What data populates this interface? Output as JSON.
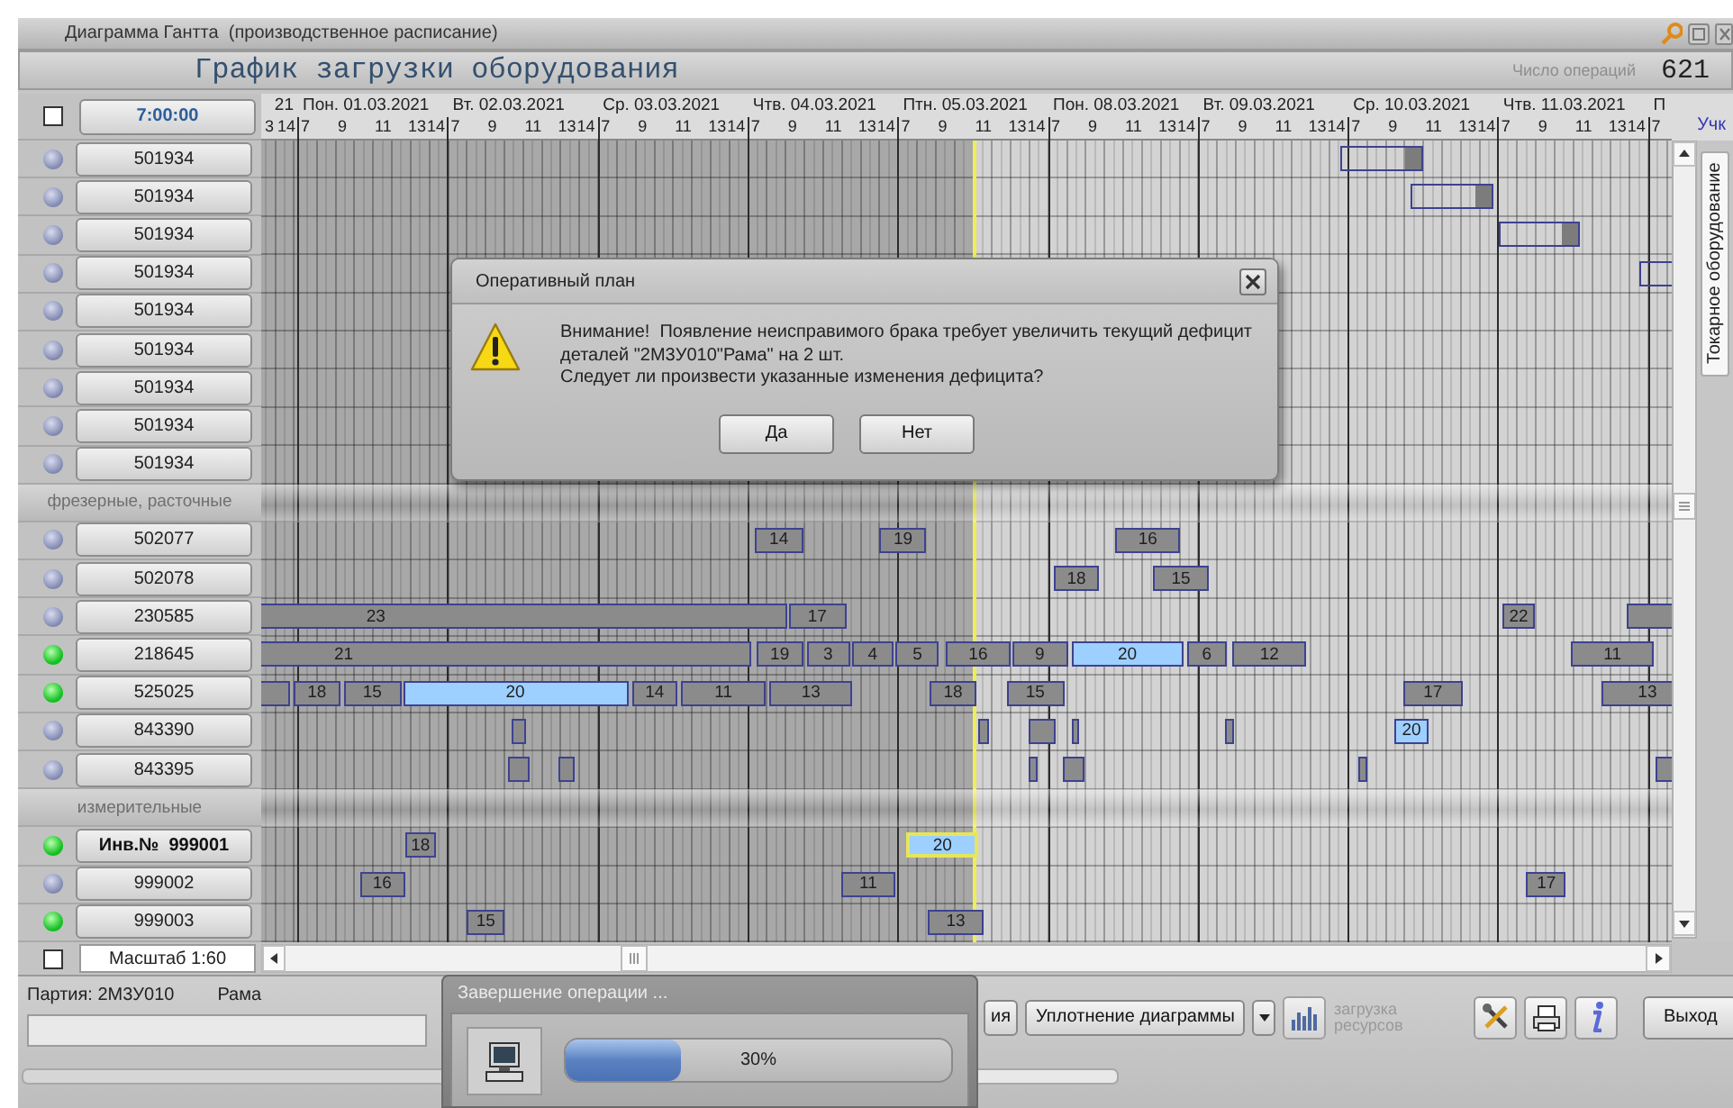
{
  "window": {
    "title": "Диаграмма Гантта  (производственное расписание)"
  },
  "header": {
    "title": "График загрузки оборудования",
    "count_label": "Число операций",
    "count": "621"
  },
  "toolbar": {
    "all_checked": false,
    "start_time": "7:00:00",
    "section_label": "Учк"
  },
  "timeline": {
    "days": [
      {
        "label": "21",
        "hours": [
          "3",
          "14"
        ]
      },
      {
        "label": "Пон. 01.03.2021",
        "hours": [
          "7",
          "9",
          "11",
          "13",
          "14"
        ]
      },
      {
        "label": "Вт. 02.03.2021",
        "hours": [
          "7",
          "9",
          "11",
          "13",
          "14"
        ]
      },
      {
        "label": "Ср. 03.03.2021",
        "hours": [
          "7",
          "9",
          "11",
          "13",
          "14"
        ]
      },
      {
        "label": "Чтв. 04.03.2021",
        "hours": [
          "7",
          "9",
          "11",
          "13",
          "14"
        ]
      },
      {
        "label": "Птн. 05.03.2021",
        "hours": [
          "7",
          "9",
          "11",
          "13",
          "14"
        ]
      },
      {
        "label": "Пон. 08.03.2021",
        "hours": [
          "7",
          "9",
          "11",
          "13",
          "14"
        ]
      },
      {
        "label": "Вт. 09.03.2021",
        "hours": [
          "7",
          "9",
          "11",
          "13",
          "14"
        ]
      },
      {
        "label": "Ср. 10.03.2021",
        "hours": [
          "7",
          "9",
          "11",
          "13",
          "14"
        ]
      },
      {
        "label": "Чтв. 11.03.2021",
        "hours": [
          "7",
          "9",
          "11",
          "13",
          "14"
        ]
      },
      {
        "label": "П",
        "hours": [
          "7"
        ]
      }
    ]
  },
  "rows": [
    {
      "kind": "machine",
      "label": "501934",
      "active": false,
      "selected": false,
      "bars": [
        {
          "kind": "pending"
        }
      ]
    },
    {
      "kind": "machine",
      "label": "501934",
      "active": false,
      "selected": false,
      "bars": [
        {
          "kind": "pending"
        }
      ]
    },
    {
      "kind": "machine",
      "label": "501934",
      "active": false,
      "selected": false,
      "bars": [
        {
          "kind": "pending"
        }
      ]
    },
    {
      "kind": "machine",
      "label": "501934",
      "active": false,
      "selected": false,
      "bars": [
        {
          "kind": "pending"
        }
      ]
    },
    {
      "kind": "machine",
      "label": "501934",
      "active": false,
      "selected": false
    },
    {
      "kind": "machine",
      "label": "501934",
      "active": false,
      "selected": false
    },
    {
      "kind": "machine",
      "label": "501934",
      "active": false,
      "selected": false
    },
    {
      "kind": "machine",
      "label": "501934",
      "active": false,
      "selected": false
    },
    {
      "kind": "machine",
      "label": "501934",
      "active": false,
      "selected": false
    },
    {
      "kind": "group",
      "label": "фрезерные, расточные"
    },
    {
      "kind": "machine",
      "label": "502077",
      "active": false,
      "selected": false,
      "bars": [
        {
          "kind": "operation",
          "label": "14"
        },
        {
          "kind": "operation",
          "label": "19"
        },
        {
          "kind": "operation",
          "label": "16"
        }
      ]
    },
    {
      "kind": "machine",
      "label": "502078",
      "active": false,
      "selected": false,
      "bars": [
        {
          "kind": "operation",
          "label": "18"
        },
        {
          "kind": "operation",
          "label": "15"
        }
      ]
    },
    {
      "kind": "machine",
      "label": "230585",
      "active": false,
      "selected": false,
      "bars": [
        {
          "kind": "operation",
          "label": "23"
        },
        {
          "kind": "operation",
          "label": "17"
        },
        {
          "kind": "operation",
          "label": "22"
        },
        {
          "kind": "operation"
        }
      ]
    },
    {
      "kind": "machine",
      "label": "218645",
      "active": true,
      "selected": false,
      "bars": [
        {
          "kind": "operation",
          "label": "21"
        },
        {
          "kind": "operation",
          "label": "19"
        },
        {
          "kind": "operation",
          "label": "3"
        },
        {
          "kind": "operation",
          "label": "4"
        },
        {
          "kind": "operation",
          "label": "5"
        },
        {
          "kind": "operation",
          "label": "16"
        },
        {
          "kind": "operation",
          "label": "9"
        },
        {
          "kind": "highlighted",
          "label": "20"
        },
        {
          "kind": "operation",
          "label": "6"
        },
        {
          "kind": "operation",
          "label": "12"
        },
        {
          "kind": "operation",
          "label": "11"
        }
      ]
    },
    {
      "kind": "machine",
      "label": "525025",
      "active": true,
      "selected": false,
      "bars": [
        {
          "kind": "operation"
        },
        {
          "kind": "operation",
          "label": "18"
        },
        {
          "kind": "operation",
          "label": "15"
        },
        {
          "kind": "highlighted",
          "label": "20"
        },
        {
          "kind": "operation",
          "label": "14"
        },
        {
          "kind": "operation",
          "label": "11"
        },
        {
          "kind": "operation",
          "label": "13"
        },
        {
          "kind": "operation",
          "label": "18"
        },
        {
          "kind": "operation",
          "label": "15"
        },
        {
          "kind": "operation",
          "label": "17"
        },
        {
          "kind": "operation",
          "label": "13"
        }
      ]
    },
    {
      "kind": "machine",
      "label": "843390",
      "active": false,
      "selected": false,
      "bars": [
        {
          "kind": "operation"
        },
        {
          "kind": "operation"
        },
        {
          "kind": "operation"
        },
        {
          "kind": "operation"
        },
        {
          "kind": "operation"
        },
        {
          "kind": "highlighted",
          "label": "20"
        }
      ]
    },
    {
      "kind": "machine",
      "label": "843395",
      "active": false,
      "selected": false,
      "bars": [
        {
          "kind": "operation"
        },
        {
          "kind": "operation"
        },
        {
          "kind": "operation"
        },
        {
          "kind": "operation"
        },
        {
          "kind": "operation"
        },
        {
          "kind": "operation"
        }
      ]
    },
    {
      "kind": "group",
      "label": "измерительные"
    },
    {
      "kind": "machine",
      "label": "Инв.№  999001",
      "active": true,
      "selected": true,
      "bars": [
        {
          "kind": "operation",
          "label": "18"
        },
        {
          "kind": "current",
          "label": "20"
        }
      ]
    },
    {
      "kind": "machine",
      "label": "999002",
      "active": false,
      "selected": false,
      "bars": [
        {
          "kind": "operation",
          "label": "16"
        },
        {
          "kind": "operation",
          "label": "11"
        },
        {
          "kind": "operation",
          "label": "17"
        }
      ]
    },
    {
      "kind": "machine",
      "label": "999003",
      "active": true,
      "selected": false,
      "bars": [
        {
          "kind": "operation",
          "label": "15"
        },
        {
          "kind": "operation",
          "label": "13"
        }
      ]
    }
  ],
  "side_tab": {
    "label": "Токарное оборудование"
  },
  "scale": {
    "checked": false,
    "label": "Масштаб 1:60"
  },
  "footer": {
    "batch": "Партия: 2М3У010",
    "part": "Рама",
    "partial_button": {
      "label": "ия"
    },
    "compact_button": {
      "label": "Уплотнение диаграммы"
    },
    "resources_button": {
      "label": "загрузка ресурсов",
      "disabled": true
    },
    "exit_button": {
      "label": "Выход"
    }
  },
  "dialog": {
    "title": "Оперативный план",
    "lines": [
      "Внимание!  Появление неисправимого брака требует увеличить текущий дефицит",
      "деталей \"2М3У010\"Рама\" на 2 шт.",
      "Следует ли произвести указанные изменения дефицита?"
    ],
    "buttons": [
      "Да",
      "Нет"
    ]
  },
  "progress": {
    "title": "Завершение операции ...",
    "level": 0.3,
    "reading": "30%"
  }
}
